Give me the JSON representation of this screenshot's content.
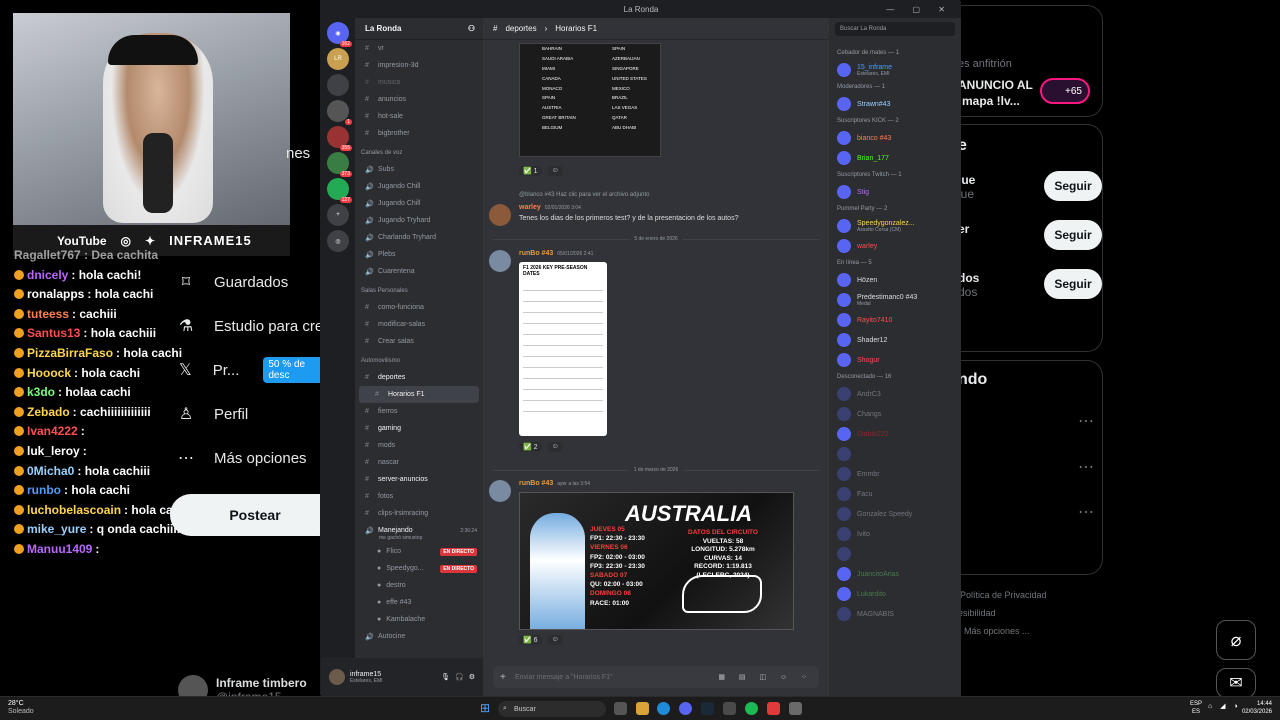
{
  "stream": {
    "social_youtube": "YouTube",
    "channel_name": "INFRAME15",
    "chat_top_partial": "Ragallet767 : Dea cachita",
    "chat": [
      {
        "user": "dnicely",
        "color": "#b968ff",
        "msg": ": hola cachi!"
      },
      {
        "user": "ronalapps",
        "color": "#ffffff",
        "msg": ": hola cachi"
      },
      {
        "user": "tuteess",
        "color": "#ff7f50",
        "msg": ": cachiii"
      },
      {
        "user": "Santus13",
        "color": "#ff4f4f",
        "msg": ": hola cachiii"
      },
      {
        "user": "PizzaBirraFaso",
        "color": "#ffd54f",
        "msg": ": hola cachi"
      },
      {
        "user": "Hooock",
        "color": "#ffd54f",
        "msg": ": hola cachi"
      },
      {
        "user": "k3do",
        "color": "#7cfc7c",
        "msg": ": holaa cachi"
      },
      {
        "user": "Zebado",
        "color": "#ffd54f",
        "msg": ": cachiiiiiiiiiiiii"
      },
      {
        "user": "Ivan4222",
        "color": "#ff4f4f",
        "msg": ":"
      },
      {
        "user": "luk_leroy",
        "color": "#ffffff",
        "msg": ":"
      },
      {
        "user": "0Micha0",
        "color": "#9ad0ff",
        "msg": ": hola cachiii"
      },
      {
        "user": "runbo",
        "color": "#4f9dff",
        "msg": ": hola cachi"
      },
      {
        "user": "luchobelascoain",
        "color": "#ffd54f",
        "msg": ": hola cachi"
      },
      {
        "user": "mike_yure",
        "color": "#9ad0ff",
        "msg": ": q onda cachiiiiiiii"
      },
      {
        "user": "Manuu1409",
        "color": "#b968ff",
        "msg": ":"
      }
    ]
  },
  "x_menu": {
    "partial_top": "nes",
    "items": [
      {
        "label": "Guardados",
        "icon": "bookmark-icon"
      },
      {
        "label": "Estudio para cre",
        "icon": "flask-icon"
      },
      {
        "label": "Pr...",
        "icon": "x-logo-icon",
        "promo": "50 % de desc"
      },
      {
        "label": "Perfil",
        "icon": "person-icon"
      },
      {
        "label": "Más opciones",
        "icon": "more-icon"
      }
    ],
    "post_label": "Postear",
    "profile_name": "Inframe timbero",
    "profile_handle": "@inframe15"
  },
  "x_right": {
    "host_label": "es anfitrión",
    "announce_1": "ANUNCIO AL",
    "announce_2": "!mapa !lv...",
    "plus_count": "+65",
    "section_e": "e",
    "who_follow": [
      {
        "name": "lue",
        "sub": "lue"
      },
      {
        "name": "er",
        "sub": ""
      },
      {
        "name": "dos",
        "sub": "dos"
      }
    ],
    "follow_label": "Seguir",
    "section_ndo": "ndo",
    "footer_1": "Política de Privacidad",
    "footer_2": "esibilidad",
    "footer_3": "Más opciones ..."
  },
  "discord": {
    "window_title": "La Ronda",
    "guild_name": "La Ronda",
    "channels_top": [
      {
        "name": "vr",
        "icon": "hash"
      },
      {
        "name": "impresion-3d",
        "icon": "hash"
      },
      {
        "name": "musica",
        "icon": "hash",
        "muted": true
      },
      {
        "name": "anuncios",
        "icon": "hash"
      },
      {
        "name": "hot-sale",
        "icon": "hash"
      },
      {
        "name": "bigbrother",
        "icon": "hash"
      }
    ],
    "voice_category": "Canales de voz",
    "voice": [
      "Subs",
      "Jugando Chill",
      "Jugando Chill",
      "Jugando Tryhard",
      "Charlando Tryhard",
      "Plebs",
      "Cuarentena"
    ],
    "personal_category": "Salas Personales",
    "personal": [
      "como-funciona",
      "modificar-salas",
      "Crear salas"
    ],
    "auto_category": "Automovilismo",
    "auto": [
      "deportes",
      "Horarios F1",
      "fierros",
      "gaming",
      "mods",
      "nascar",
      "server-anuncios",
      "fotos",
      "clips-lrsimracing"
    ],
    "voice_active_channel": "Manejando",
    "voice_active_sub": "me gachó simustop",
    "voice_active_time": "2:36:24",
    "voice_users": [
      {
        "name": "Flico",
        "live": "EN DIRECTO"
      },
      {
        "name": "Speedygo...",
        "live": "EN DIRECTO"
      },
      {
        "name": "destro",
        "live": ""
      },
      {
        "name": "effe #43",
        "live": ""
      },
      {
        "name": "Kambalache",
        "live": ""
      }
    ],
    "autocine": "Autocine",
    "user_name": "inframe15",
    "user_status": "Estelares, EMI",
    "breadcrumb_parent": "deportes",
    "breadcrumb_thread": "Horarios F1",
    "search_placeholder": "Buscar La Ronda",
    "flags_left": [
      "BAHRAIN",
      "SAUDI ARABIA",
      "MIAMI",
      "CANADA",
      "MONACO",
      "SPAIN",
      "AUSTRIA",
      "GREAT BRITAIN",
      "BELGIUM"
    ],
    "flags_right": [
      "SPAIN",
      "AZERBAIJAN",
      "SINGAPORE",
      "UNITED STATES",
      "MEXICO",
      "BRAZIL",
      "LAS VEGAS",
      "QATAR",
      "ABU DHABI"
    ],
    "reaction_1": "1",
    "reply_preview": "@blanco #43 Haz clic para ver el archivo adjunto",
    "msg_warley": {
      "name": "warley",
      "time": "02/01/2026 3:04",
      "text": "Tenes los dias de los primeros test? y de la presentacion de los autos?"
    },
    "date_1": "5 de enero de 2026",
    "msg_runbo_1": {
      "name": "runBo #43",
      "time": "05/01/2026 2:41"
    },
    "doc_title": "F1 2026 KEY PRE-SEASON DATES",
    "reaction_2": "2",
    "date_2": "1 de marzo de 2026",
    "msg_runbo_2": {
      "name": "runBo #43",
      "time": "ayer a las 3:54"
    },
    "race_title": "AUSTRALIA",
    "race_sched": [
      {
        "day": "JUEVES 05",
        "line": "FP1: 22:30 - 23:30"
      },
      {
        "day": "VIERNES 06",
        "line": "FP2: 02:00 - 03:00"
      },
      {
        "day": "",
        "line": "FP3: 22:30 - 23:30"
      },
      {
        "day": "SABADO 07",
        "line": "QU: 02:00 - 03:00"
      },
      {
        "day": "DOMINGO 08",
        "line": "RACE: 01:00"
      }
    ],
    "circuit_title": "DATOS DEL CIRCUITO",
    "circuit_lines": [
      "VUELTAS: 58",
      "LONGITUD: 5.278km",
      "CURVAS: 14",
      "RECORD: 1:19.813",
      "(LECLERC, 2024)"
    ],
    "reaction_3": "6",
    "composer_placeholder": "Enviar mensaje a \"Horarios F1\"",
    "member_groups": [
      {
        "title": "Cebador de mates — 1",
        "members": [
          {
            "name": "15_inframe",
            "color": "#4f9dff",
            "sub": "Estelares, EMI"
          }
        ]
      },
      {
        "title": "Moderadores — 1",
        "members": [
          {
            "name": "Strawn#43",
            "color": "#9ad0ff",
            "sub": ""
          }
        ]
      },
      {
        "title": "Suscriptores KICK — 2",
        "members": [
          {
            "name": "bianco #43",
            "color": "#ff7f50",
            "sub": ""
          },
          {
            "name": "Brian_177",
            "color": "#53fc18",
            "sub": ""
          }
        ]
      },
      {
        "title": "Suscriptores Twitch — 1",
        "members": [
          {
            "name": "Stig",
            "color": "#b968ff",
            "sub": ""
          }
        ]
      },
      {
        "title": "Pummel Party — 2",
        "members": [
          {
            "name": "Speedygonzalez...",
            "color": "#ffd54f",
            "sub": "Assetto Corsa (CM)"
          },
          {
            "name": "warley",
            "color": "#ff4f4f",
            "sub": ""
          }
        ]
      },
      {
        "title": "En línea — 5",
        "members": [
          {
            "name": "Hözen",
            "color": "#dbdee1",
            "sub": ""
          },
          {
            "name": "Predestimanc0 #43",
            "color": "#dbdee1",
            "sub": "Medal"
          },
          {
            "name": "Rayito7410",
            "color": "#ff4f4f",
            "sub": ""
          },
          {
            "name": "Shader12",
            "color": "#dbdee1",
            "sub": ""
          },
          {
            "name": "Shogur",
            "color": "#ff4f4f",
            "sub": ""
          }
        ]
      },
      {
        "title": "Desconectado — 16",
        "members": [
          {
            "name": "AndrC3",
            "color": "#72767d",
            "sub": ""
          },
          {
            "name": "Changs",
            "color": "#72767d",
            "sub": ""
          },
          {
            "name": "Diablo222",
            "color": "#8a2a2a",
            "sub": ""
          },
          {
            "name": "",
            "color": "#72767d",
            "sub": ""
          },
          {
            "name": "Emmbr",
            "color": "#72767d",
            "sub": ""
          },
          {
            "name": "Facu",
            "color": "#72767d",
            "sub": ""
          },
          {
            "name": "Gonzalez Speedy",
            "color": "#72767d",
            "sub": ""
          },
          {
            "name": "Ivito",
            "color": "#72767d",
            "sub": ""
          },
          {
            "name": "",
            "color": "#72767d",
            "sub": ""
          },
          {
            "name": "JuancitoArias",
            "color": "#4a7a4a",
            "sub": ""
          },
          {
            "name": "Lukardito",
            "color": "#4a7a4a",
            "sub": ""
          },
          {
            "name": "MAGNABIS",
            "color": "#72767d",
            "sub": ""
          }
        ]
      }
    ]
  },
  "taskbar": {
    "weather_temp": "28°C",
    "weather_desc": "Soleado",
    "search": "Buscar",
    "lang": "ESP",
    "lang_sub": "ES",
    "time": "14:44",
    "date": "02/03/2026"
  }
}
